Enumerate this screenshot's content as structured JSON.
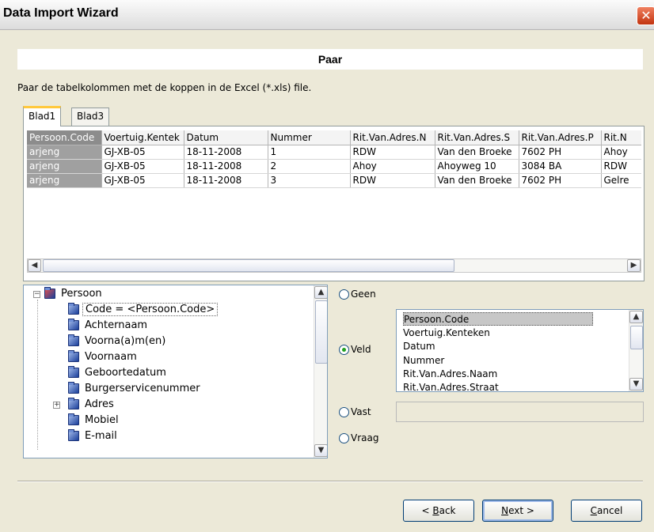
{
  "window": {
    "title": "Data Import Wizard"
  },
  "header": {
    "title": "Paar"
  },
  "description": "Paar de tabelkolommen met de koppen in de Excel (*.xls) file.",
  "tabs": [
    {
      "label": "Blad1",
      "active": true
    },
    {
      "label": "Blad3",
      "active": false
    }
  ],
  "grid": {
    "columns": [
      "Persoon.Code",
      "Voertuig.Kentek",
      "Datum",
      "Nummer",
      "Rit.Van.Adres.N",
      "Rit.Van.Adres.S",
      "Rit.Van.Adres.P",
      "Rit.N"
    ],
    "rows": [
      [
        "arjeng",
        "GJ-XB-05",
        "18-11-2008",
        "1",
        "RDW",
        "Van den Broeke",
        "7602 PH",
        "Ahoy"
      ],
      [
        "arjeng",
        "GJ-XB-05",
        "18-11-2008",
        "2",
        "Ahoy",
        "Ahoyweg 10",
        "3084 BA",
        "RDW"
      ],
      [
        "arjeng",
        "GJ-XB-05",
        "18-11-2008",
        "3",
        "RDW",
        "Van den Broeke",
        "7602 PH",
        "Gelre"
      ]
    ]
  },
  "tree": {
    "root": "Persoon",
    "items": [
      {
        "label": "Code = <Persoon.Code>",
        "selected": true
      },
      {
        "label": "Achternaam"
      },
      {
        "label": "Voorna(a)m(en)"
      },
      {
        "label": "Voornaam"
      },
      {
        "label": "Geboortedatum"
      },
      {
        "label": "Burgerservicenummer"
      },
      {
        "label": "Adres",
        "expandable": true
      },
      {
        "label": "Mobiel"
      },
      {
        "label": "E-mail"
      }
    ]
  },
  "options": {
    "geen": "Geen",
    "veld": "Veld",
    "vast": "Vast",
    "vraag": "Vraag",
    "selected": "Veld"
  },
  "field_list": {
    "items": [
      "Persoon.Code",
      "Voertuig.Kenteken",
      "Datum",
      "Nummer",
      "Rit.Van.Adres.Naam",
      "Rit.Van.Adres.Straat"
    ],
    "selected": "Persoon.Code"
  },
  "buttons": {
    "back": {
      "prefix": "< ",
      "mnemonic": "B",
      "rest": "ack"
    },
    "next": {
      "mnemonic": "N",
      "rest": "ext >"
    },
    "cancel": {
      "mnemonic": "C",
      "rest": "ancel"
    }
  },
  "icons": {
    "close": "close-icon",
    "folder": "folder-icon",
    "tree_expand": "plus-icon",
    "tree_collapse": "minus-icon"
  }
}
